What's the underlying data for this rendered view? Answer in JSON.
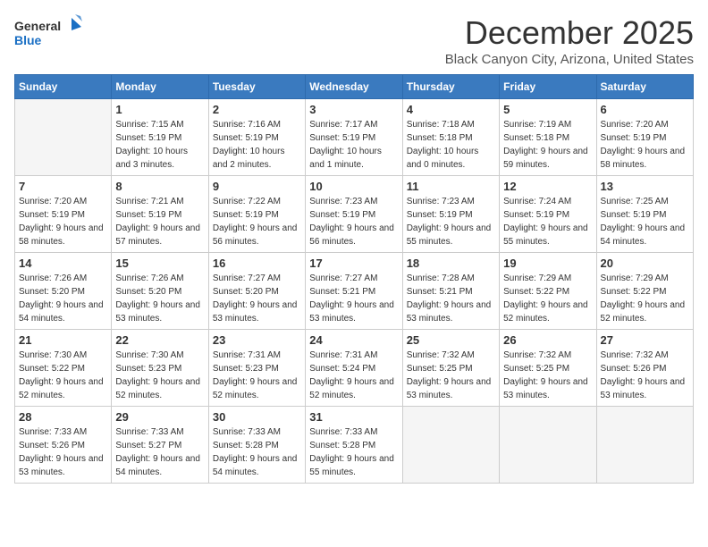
{
  "logo": {
    "line1": "General",
    "line2": "Blue"
  },
  "title": "December 2025",
  "subtitle": "Black Canyon City, Arizona, United States",
  "weekdays": [
    "Sunday",
    "Monday",
    "Tuesday",
    "Wednesday",
    "Thursday",
    "Friday",
    "Saturday"
  ],
  "weeks": [
    [
      {
        "day": "",
        "empty": true
      },
      {
        "day": "1",
        "sunrise": "7:15 AM",
        "sunset": "5:19 PM",
        "daylight": "10 hours and 3 minutes."
      },
      {
        "day": "2",
        "sunrise": "7:16 AM",
        "sunset": "5:19 PM",
        "daylight": "10 hours and 2 minutes."
      },
      {
        "day": "3",
        "sunrise": "7:17 AM",
        "sunset": "5:19 PM",
        "daylight": "10 hours and 1 minute."
      },
      {
        "day": "4",
        "sunrise": "7:18 AM",
        "sunset": "5:18 PM",
        "daylight": "10 hours and 0 minutes."
      },
      {
        "day": "5",
        "sunrise": "7:19 AM",
        "sunset": "5:18 PM",
        "daylight": "9 hours and 59 minutes."
      },
      {
        "day": "6",
        "sunrise": "7:20 AM",
        "sunset": "5:19 PM",
        "daylight": "9 hours and 58 minutes."
      }
    ],
    [
      {
        "day": "7",
        "sunrise": "7:20 AM",
        "sunset": "5:19 PM",
        "daylight": "9 hours and 58 minutes."
      },
      {
        "day": "8",
        "sunrise": "7:21 AM",
        "sunset": "5:19 PM",
        "daylight": "9 hours and 57 minutes."
      },
      {
        "day": "9",
        "sunrise": "7:22 AM",
        "sunset": "5:19 PM",
        "daylight": "9 hours and 56 minutes."
      },
      {
        "day": "10",
        "sunrise": "7:23 AM",
        "sunset": "5:19 PM",
        "daylight": "9 hours and 56 minutes."
      },
      {
        "day": "11",
        "sunrise": "7:23 AM",
        "sunset": "5:19 PM",
        "daylight": "9 hours and 55 minutes."
      },
      {
        "day": "12",
        "sunrise": "7:24 AM",
        "sunset": "5:19 PM",
        "daylight": "9 hours and 55 minutes."
      },
      {
        "day": "13",
        "sunrise": "7:25 AM",
        "sunset": "5:19 PM",
        "daylight": "9 hours and 54 minutes."
      }
    ],
    [
      {
        "day": "14",
        "sunrise": "7:26 AM",
        "sunset": "5:20 PM",
        "daylight": "9 hours and 54 minutes."
      },
      {
        "day": "15",
        "sunrise": "7:26 AM",
        "sunset": "5:20 PM",
        "daylight": "9 hours and 53 minutes."
      },
      {
        "day": "16",
        "sunrise": "7:27 AM",
        "sunset": "5:20 PM",
        "daylight": "9 hours and 53 minutes."
      },
      {
        "day": "17",
        "sunrise": "7:27 AM",
        "sunset": "5:21 PM",
        "daylight": "9 hours and 53 minutes."
      },
      {
        "day": "18",
        "sunrise": "7:28 AM",
        "sunset": "5:21 PM",
        "daylight": "9 hours and 53 minutes."
      },
      {
        "day": "19",
        "sunrise": "7:29 AM",
        "sunset": "5:22 PM",
        "daylight": "9 hours and 52 minutes."
      },
      {
        "day": "20",
        "sunrise": "7:29 AM",
        "sunset": "5:22 PM",
        "daylight": "9 hours and 52 minutes."
      }
    ],
    [
      {
        "day": "21",
        "sunrise": "7:30 AM",
        "sunset": "5:22 PM",
        "daylight": "9 hours and 52 minutes."
      },
      {
        "day": "22",
        "sunrise": "7:30 AM",
        "sunset": "5:23 PM",
        "daylight": "9 hours and 52 minutes."
      },
      {
        "day": "23",
        "sunrise": "7:31 AM",
        "sunset": "5:23 PM",
        "daylight": "9 hours and 52 minutes."
      },
      {
        "day": "24",
        "sunrise": "7:31 AM",
        "sunset": "5:24 PM",
        "daylight": "9 hours and 52 minutes."
      },
      {
        "day": "25",
        "sunrise": "7:32 AM",
        "sunset": "5:25 PM",
        "daylight": "9 hours and 53 minutes."
      },
      {
        "day": "26",
        "sunrise": "7:32 AM",
        "sunset": "5:25 PM",
        "daylight": "9 hours and 53 minutes."
      },
      {
        "day": "27",
        "sunrise": "7:32 AM",
        "sunset": "5:26 PM",
        "daylight": "9 hours and 53 minutes."
      }
    ],
    [
      {
        "day": "28",
        "sunrise": "7:33 AM",
        "sunset": "5:26 PM",
        "daylight": "9 hours and 53 minutes."
      },
      {
        "day": "29",
        "sunrise": "7:33 AM",
        "sunset": "5:27 PM",
        "daylight": "9 hours and 54 minutes."
      },
      {
        "day": "30",
        "sunrise": "7:33 AM",
        "sunset": "5:28 PM",
        "daylight": "9 hours and 54 minutes."
      },
      {
        "day": "31",
        "sunrise": "7:33 AM",
        "sunset": "5:28 PM",
        "daylight": "9 hours and 55 minutes."
      },
      {
        "day": "",
        "empty": true
      },
      {
        "day": "",
        "empty": true
      },
      {
        "day": "",
        "empty": true
      }
    ]
  ]
}
